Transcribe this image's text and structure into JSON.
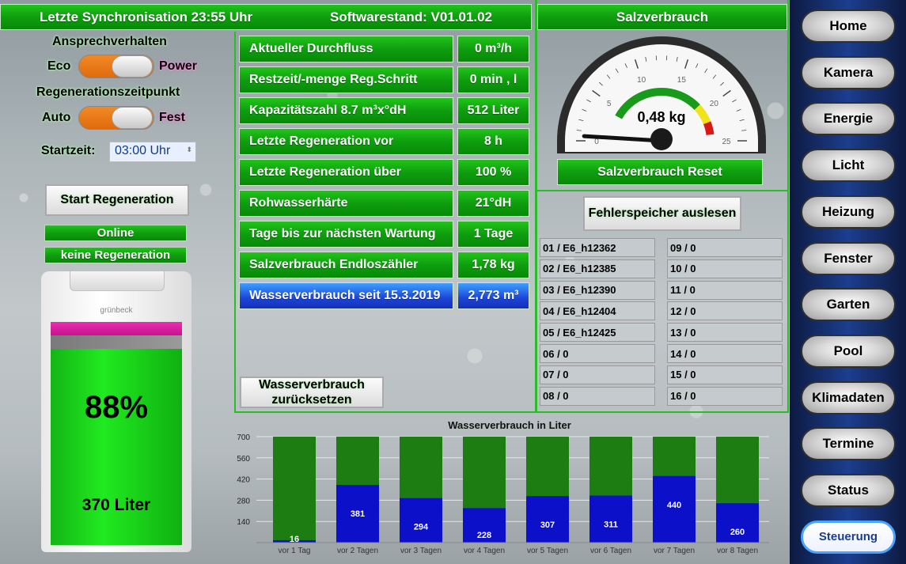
{
  "header": {
    "sync": "Letzte Synchronisation 23:55 Uhr",
    "software": "Softwarestand: V01.01.02",
    "salt_title": "Salzverbrauch"
  },
  "left": {
    "ansprech_label": "Ansprechverhalten",
    "eco": "Eco",
    "power": "Power",
    "regen_label": "Regenerationszeitpunkt",
    "auto": "Auto",
    "fest": "Fest",
    "start_label": "Startzeit:",
    "start_value": "03:00 Uhr",
    "start_button": "Start Regeneration",
    "status_online": "Online",
    "status_regen": "keine Regeneration",
    "brand": "grünbeck",
    "percent": "88%",
    "liters": "370 Liter",
    "fill_fraction": 0.88
  },
  "info_rows": [
    {
      "label": "Aktueller Durchfluss",
      "value": "0 m³/h"
    },
    {
      "label": "Restzeit/-menge Reg.Schritt",
      "value": "0 min , l"
    },
    {
      "label": "Kapazitätszahl 8.7 m³x°dH",
      "value": "512 Liter"
    },
    {
      "label": "Letzte Regeneration vor",
      "value": "8 h"
    },
    {
      "label": "Letzte Regeneration über",
      "value": "100 %"
    },
    {
      "label": "Rohwasserhärte",
      "value": "21°dH"
    },
    {
      "label": "Tage bis zur nächsten Wartung",
      "value": "1 Tage"
    },
    {
      "label": "Salzverbrauch Endloszähler",
      "value": "1,78 kg"
    },
    {
      "label": "Wasserverbrauch seit 15.3.2019",
      "value": "2,773 m³"
    }
  ],
  "reset_water_button": "Wasserverbrauch zurücksetzen",
  "gauge": {
    "value_text": "0,48 kg",
    "value": 0.48,
    "min": 0,
    "max": 25,
    "ticks": [
      "0",
      "5",
      "10",
      "15",
      "20",
      "25"
    ],
    "colors": {
      "green": "#1a9a1a",
      "yellow": "#f2e21a",
      "red": "#d81818"
    }
  },
  "salt_reset_button": "Salzverbrauch Reset",
  "error_button": "Fehlerspeicher auslesen",
  "errors_left": [
    "01 / E6_h12362",
    "02 / E6_h12385",
    "03 / E6_h12390",
    "04 / E6_h12404",
    "05 / E6_h12425",
    "06 / 0",
    "07 / 0",
    "08 / 0"
  ],
  "errors_right": [
    "09 / 0",
    "10 / 0",
    "11 / 0",
    "12 / 0",
    "13 / 0",
    "14 / 0",
    "15 / 0",
    "16 / 0"
  ],
  "nav": {
    "items": [
      "Home",
      "Kamera",
      "Energie",
      "Licht",
      "Heizung",
      "Fenster",
      "Garten",
      "Pool",
      "Klimadaten",
      "Termine",
      "Status",
      "Steuerung"
    ],
    "active": "Steuerung"
  },
  "chart_data": {
    "type": "bar",
    "title": "Wasserverbrauch in Liter",
    "categories": [
      "vor 1 Tag",
      "vor 2 Tagen",
      "vor 3 Tagen",
      "vor 4 Tagen",
      "vor 5 Tagen",
      "vor 6 Tagen",
      "vor 7 Tagen",
      "vor 8 Tagen"
    ],
    "values": [
      16,
      381,
      294,
      228,
      307,
      311,
      440,
      260
    ],
    "background_max": 700,
    "yticks": [
      140,
      280,
      420,
      560,
      700
    ],
    "ylim": [
      0,
      700
    ],
    "colors": {
      "value": "#0c10c8",
      "background": "#1e7d12"
    }
  }
}
